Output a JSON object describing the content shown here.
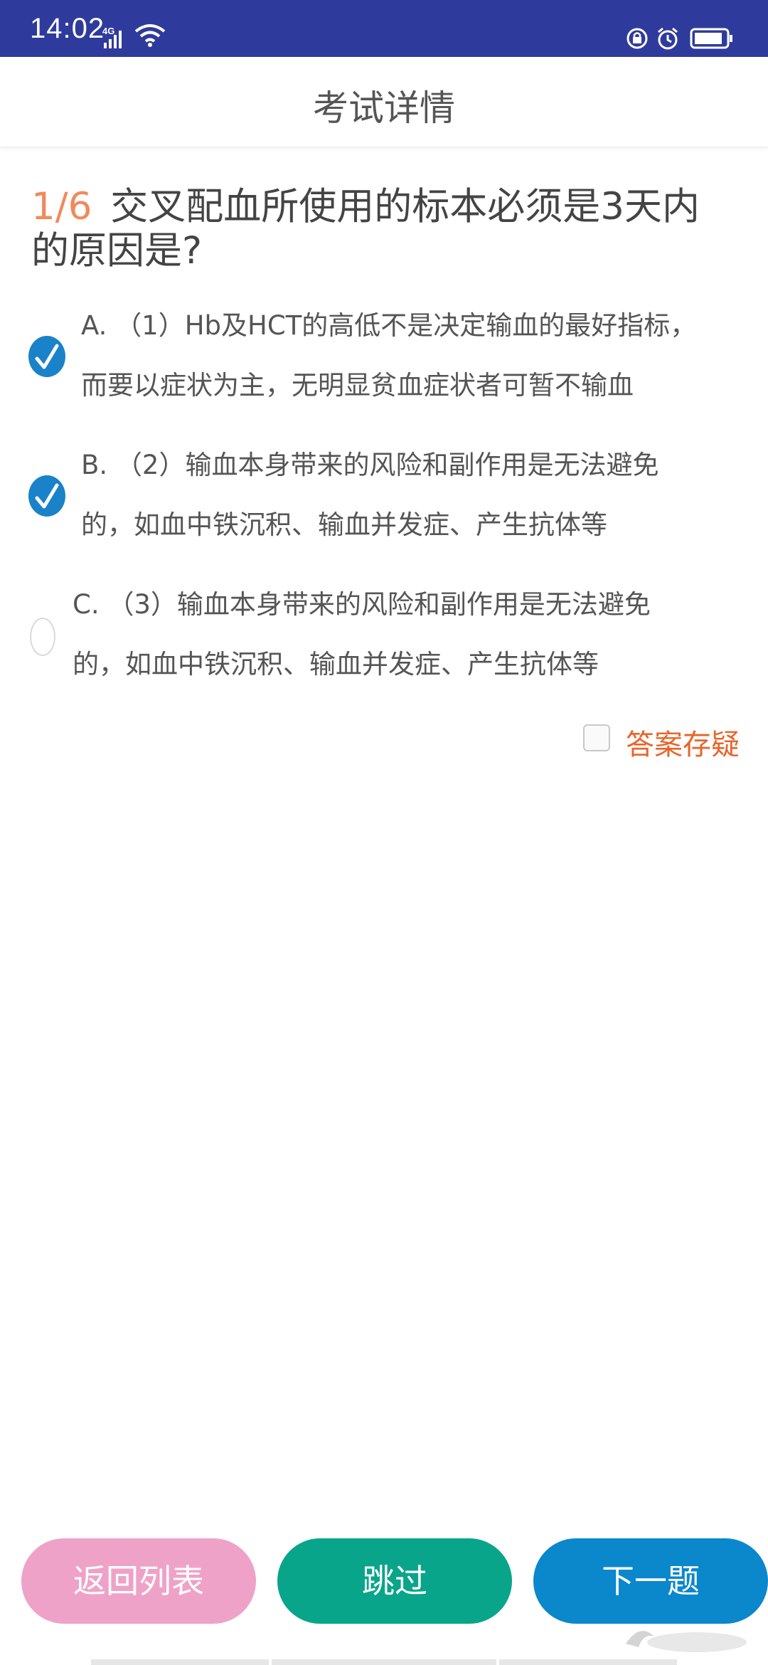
{
  "status_bar": {
    "time": "14:02",
    "network": "4G"
  },
  "header": {
    "title": "考试详情"
  },
  "question": {
    "number": "1/6",
    "text": "交叉配血所使用的标本必须是3天内的原因是?"
  },
  "options": [
    {
      "line1": "A. （1）Hb及HCT的高低不是决定输血的最好指标，",
      "line2": "而要以症状为主，无明显贫血症状者可暂不输血",
      "selected": true
    },
    {
      "line1": "B. （2）输血本身带来的风险和副作用是无法避免",
      "line2": "的，如血中铁沉积、输血并发症、产生抗体等",
      "selected": true
    },
    {
      "line1": "C. （3）输血本身带来的风险和副作用是无法避免",
      "line2": "的，如血中铁沉积、输血并发症、产生抗体等",
      "selected": false
    }
  ],
  "doubt": {
    "label": "答案存疑",
    "checked": false
  },
  "buttons": {
    "back": "返回列表",
    "skip": "跳过",
    "next": "下一题"
  },
  "colors": {
    "status_bar": "#2f3b9c",
    "question_number": "#ef8a5a",
    "check_selected": "#1a82c8",
    "doubt_label": "#e8652a",
    "btn_back": "#efa2c7",
    "btn_skip": "#09a58b",
    "btn_next": "#0b87cc"
  }
}
